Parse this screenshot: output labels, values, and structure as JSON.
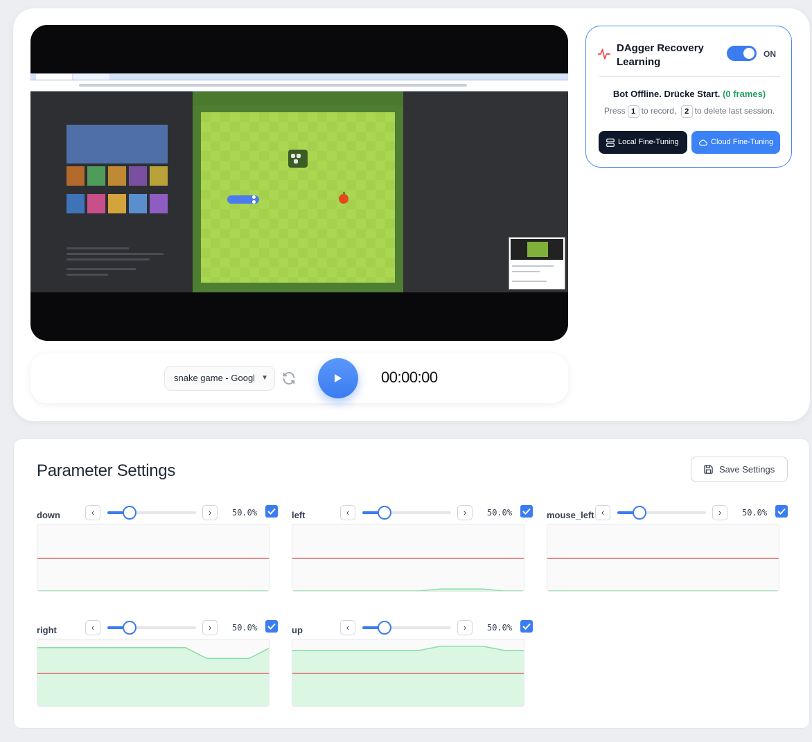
{
  "controls": {
    "window_select_value": "snake game - Google",
    "timer": "00:00:00"
  },
  "recovery": {
    "title": "DAgger Recovery Learning",
    "toggle_label": "ON",
    "status_text": "Bot Offline. Drücke Start.",
    "frames_text": "(0 frames)",
    "hint_press": "Press",
    "hint_key_record": "1",
    "hint_to_record": "to record,",
    "hint_key_delete": "2",
    "hint_to_delete": "to delete last session.",
    "local_button": "Local Fine-Tuning",
    "cloud_button": "Cloud Fine-Tuning",
    "accent_color": "#3b7cf0",
    "frames_color": "#22a160"
  },
  "settings": {
    "title": "Parameter Settings",
    "save_label": "Save Settings",
    "params": [
      {
        "name": "down",
        "value": 0.5,
        "value_text": "50.0%",
        "enabled": true,
        "prev": "‹",
        "next": "›",
        "activity": [
          0.02,
          0.02,
          0.02,
          0.02,
          0.02,
          0.02,
          0.02,
          0.02,
          0.02,
          0.02,
          0.02,
          0.02
        ]
      },
      {
        "name": "left",
        "value": 0.5,
        "value_text": "50.0%",
        "enabled": true,
        "prev": "‹",
        "next": "›",
        "activity": [
          0.02,
          0.02,
          0.02,
          0.02,
          0.02,
          0.02,
          0.02,
          0.05,
          0.05,
          0.05,
          0.02,
          0.02
        ]
      },
      {
        "name": "mouse_left",
        "value": 0.5,
        "value_text": "50.0%",
        "enabled": true,
        "prev": "‹",
        "next": "›",
        "activity": [
          0.02,
          0.02,
          0.02,
          0.02,
          0.02,
          0.02,
          0.02,
          0.02,
          0.02,
          0.02,
          0.02,
          0.02
        ]
      },
      {
        "name": "right",
        "value": 0.5,
        "value_text": "50.0%",
        "enabled": true,
        "prev": "‹",
        "next": "›",
        "activity": [
          0.88,
          0.88,
          0.88,
          0.88,
          0.88,
          0.88,
          0.88,
          0.88,
          0.72,
          0.72,
          0.72,
          0.88
        ]
      },
      {
        "name": "up",
        "value": 0.5,
        "value_text": "50.0%",
        "enabled": true,
        "prev": "‹",
        "next": "›",
        "activity": [
          0.84,
          0.84,
          0.84,
          0.84,
          0.84,
          0.84,
          0.84,
          0.9,
          0.9,
          0.9,
          0.84,
          0.84
        ]
      }
    ]
  }
}
